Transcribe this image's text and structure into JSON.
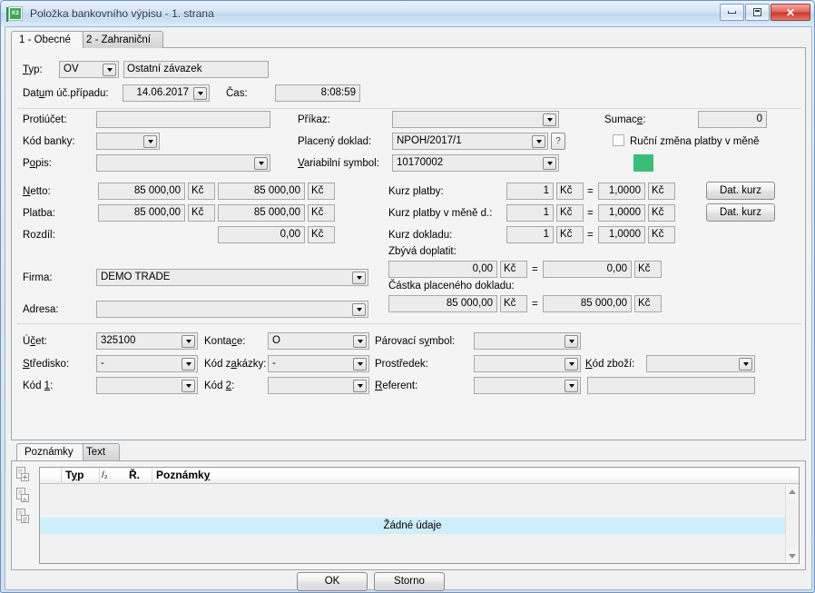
{
  "window": {
    "title": "Položka bankovního výpisu - 1. strana",
    "app_icon": "k2-app-icon",
    "minimize": "minimize-button",
    "restore": "restore-button",
    "close": "✕"
  },
  "tabs": [
    {
      "label": "1 - Obecné",
      "active": true
    },
    {
      "label": "2 - Zahraniční",
      "active": false
    }
  ],
  "form": {
    "typ_label": "Typ:",
    "typ_value": "OV",
    "typ_desc": "Ostatní závazek",
    "datum_label": "Datum úč.případu:",
    "datum_value": "14.06.2017",
    "cas_label": "Čas:",
    "cas_value": "8:08:59",
    "protiucet_label": "Protiúčet:",
    "protiucet_value": "",
    "kod_banky_label": "Kód banky:",
    "kod_banky_value": "",
    "popis_label": "Popis:",
    "popis_value": "",
    "prikaz_label": "Příkaz:",
    "prikaz_value": "",
    "placeny_doklad_label": "Placený doklad:",
    "placeny_doklad_value": "NPOH/2017/1",
    "help_button": "?",
    "variabilni_symbol_label": "Variabilní symbol:",
    "variabilni_symbol_value": "10170002",
    "sumace_label": "Sumace:",
    "sumace_value": "0",
    "rucni_zmena_label": "Ruční změna platby v měně",
    "rucni_zmena_checked": false,
    "status_color": "#3cbd77",
    "netto_label": "Netto:",
    "netto_value_1": "85 000,00",
    "netto_value_2": "85 000,00",
    "platba_label": "Platba:",
    "platba_value_1": "85 000,00",
    "platba_value_2": "85 000,00",
    "rozdil_label": "Rozdíl:",
    "rozdil_value": "0,00",
    "currency": "Kč",
    "kurz_platby_label": "Kurz platby:",
    "kurz_platby_a": "1",
    "kurz_platby_b": "1,0000",
    "kurz_platby_mene_label": "Kurz platby v měně d.:",
    "kurz_platby_mene_a": "1",
    "kurz_platby_mene_b": "1,0000",
    "kurz_dokladu_label": "Kurz dokladu:",
    "kurz_dokladu_a": "1",
    "kurz_dokladu_b": "1,0000",
    "dat_kurz_button": "Dat. kurz",
    "equals": "=",
    "zbyva_doplatit_label": "Zbývá doplatit:",
    "zbyva_doplatit_a": "0,00",
    "zbyva_doplatit_b": "0,00",
    "castka_placeneho_label": "Částka placeného dokladu:",
    "castka_placeneho_a": "85 000,00",
    "castka_placeneho_b": "85 000,00",
    "firma_label": "Firma:",
    "firma_value": "DEMO TRADE",
    "adresa_label": "Adresa:",
    "adresa_value": ""
  },
  "accounting": {
    "ucet_label": "Účet:",
    "ucet_value": "325100",
    "kontace_label": "Kontace:",
    "kontace_value": "O",
    "parovaci_symbol_label": "Párovací symbol:",
    "parovaci_symbol_value": "",
    "stredisko_label": "Středisko:",
    "stredisko_value": "-",
    "kod_zakazky_label": "Kód zakázky:",
    "kod_zakazky_value": "-",
    "prostredek_label": "Prostředek:",
    "prostredek_value": "",
    "kod_zbozi_label": "Kód zboží:",
    "kod_zbozi_value": "",
    "kod1_label": "Kód 1:",
    "kod1_value": "",
    "kod2_label": "Kód 2:",
    "kod2_value": "",
    "referent_label": "Referent:",
    "referent_value": "",
    "referent_extra_value": ""
  },
  "notes": {
    "tabs": [
      {
        "label": "Poznámky",
        "active": true
      },
      {
        "label": "Text",
        "active": false
      }
    ],
    "side_icons": [
      "note-new-icon",
      "note-image-icon",
      "note-copy-icon"
    ],
    "grid": {
      "columns": [
        "Typ",
        "Ř.",
        "Poznámky"
      ],
      "sort_indicator": "/₂",
      "empty_message": "Žádné údaje",
      "rows": []
    },
    "scrollbar": {
      "up": "scroll-up-arrow",
      "down": "scroll-down-arrow"
    }
  },
  "footer": {
    "ok_label": "OK",
    "cancel_label": "Storno"
  }
}
